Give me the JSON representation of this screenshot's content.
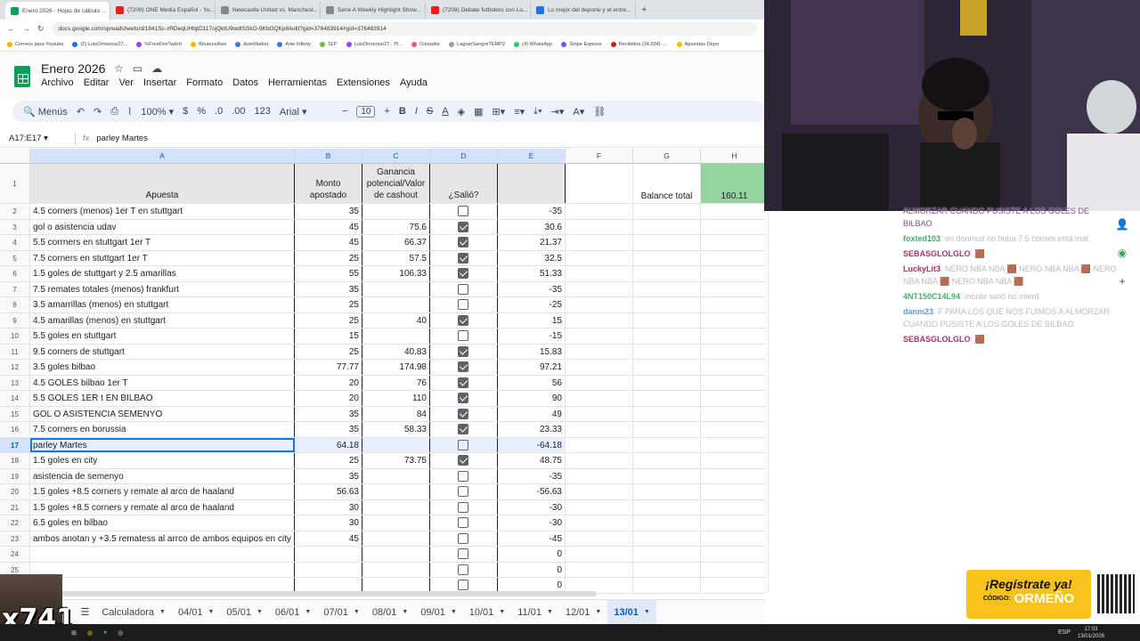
{
  "browser": {
    "tabs": [
      {
        "label": "Enero 2026 - Hojas de cálculo ...",
        "active": true,
        "color": "#0f9d58"
      },
      {
        "label": "(7209) ONE Media Español - Yo...",
        "active": false,
        "color": "#e62117"
      },
      {
        "label": "Newcastle United vs. Manchest...",
        "active": false,
        "color": "#888888"
      },
      {
        "label": "Serie A Weekly Highlight Show...",
        "active": false,
        "color": "#888888"
      },
      {
        "label": "(7209) Debate futbolero con Lo...",
        "active": false,
        "color": "#e62117"
      },
      {
        "label": "Lo mejor del deporte y el entre...",
        "active": false,
        "color": "#1a73e8"
      }
    ],
    "url": "docs.google.com/spreadsheets/d/1841Sc-zRDeqUHbjtD117ojQktU9wdtSSkO-9KbOQKp8/edit?gid=376483914#gid=376483914",
    "bookmarks": [
      "Correos para Youtube",
      "(2) LuisOrmenoe27...",
      "%FreeFireTwitch",
      "BinanceAxie",
      "AxieMarket",
      "Axie Infinity",
      "SLP",
      "LuisOrmenoe27 - Pl...",
      "Contador",
      "LagranSangreTEMP2",
      "(4) WhatsApp",
      "Stripe Express",
      "Recibidos (34,934) -...",
      "Apuestas Depo"
    ]
  },
  "doc": {
    "title": "Enero 2026",
    "menu": [
      "Archivo",
      "Editar",
      "Ver",
      "Insertar",
      "Formato",
      "Datos",
      "Herramientas",
      "Extensiones",
      "Ayuda"
    ]
  },
  "toolbar": {
    "search": "Menús",
    "zoom": "100%",
    "currency": "$",
    "percent": "%",
    "dec_less": ".0",
    "dec_more": ".00",
    "numfmt": "123",
    "font": "Arial",
    "font_size": "10"
  },
  "formula": {
    "namebox": "A17:E17",
    "fx": "fx",
    "value": "parley Martes"
  },
  "columns": [
    "A",
    "B",
    "C",
    "D",
    "E",
    "F",
    "G",
    "H"
  ],
  "header_row": {
    "num": "1",
    "apuesta": "Apuesta",
    "monto": "Monto apostado",
    "ganancia": "Ganancia potencial/Valor de cashout",
    "salio": "¿Salió?",
    "balance_label": "Balance total",
    "balance_value": "160.11"
  },
  "rows": [
    {
      "n": "2",
      "a": "4.5 corners (menos) 1er T en stuttgart",
      "b": "35",
      "c": "",
      "d": false,
      "e": "-35"
    },
    {
      "n": "3",
      "a": "gol o asistencia udav",
      "b": "45",
      "c": "75.6",
      "d": true,
      "e": "30.6"
    },
    {
      "n": "4",
      "a": "5.5 corrners en stuttgart 1er T",
      "b": "45",
      "c": "66.37",
      "d": true,
      "e": "21.37"
    },
    {
      "n": "5",
      "a": "7.5 corners en stuttgart 1er T",
      "b": "25",
      "c": "57.5",
      "d": true,
      "e": "32.5"
    },
    {
      "n": "6",
      "a": "1.5 goles de stuttgart y 2.5 amarillas",
      "b": "55",
      "c": "106.33",
      "d": true,
      "e": "51.33"
    },
    {
      "n": "7",
      "a": "7.5 remates totales (menos) frankfurt",
      "b": "35",
      "c": "",
      "d": false,
      "e": "-35"
    },
    {
      "n": "8",
      "a": "3.5 amarrillas (menos) en stuttgart",
      "b": "25",
      "c": "",
      "d": false,
      "e": "-25"
    },
    {
      "n": "9",
      "a": "4.5 amarillas (menos) en stuttgart",
      "b": "25",
      "c": "40",
      "d": true,
      "e": "15"
    },
    {
      "n": "10",
      "a": "5.5 goles en stuttgart",
      "b": "15",
      "c": "",
      "d": false,
      "e": "-15"
    },
    {
      "n": "11",
      "a": "9.5 corners de stuttgart",
      "b": "25",
      "c": "40.83",
      "d": true,
      "e": "15.83"
    },
    {
      "n": "12",
      "a": "3.5 goles bilbao",
      "b": "77.77",
      "c": "174.98",
      "d": true,
      "e": "97.21"
    },
    {
      "n": "13",
      "a": "4.5 GOLES bilbao 1er T",
      "b": "20",
      "c": "76",
      "d": true,
      "e": "56"
    },
    {
      "n": "14",
      "a": "5.5 GOLES 1ER t EN BILBAO",
      "b": "20",
      "c": "110",
      "d": true,
      "e": "90"
    },
    {
      "n": "15",
      "a": "GOL O ASISTENCIA SEMENYO",
      "b": "35",
      "c": "84",
      "d": true,
      "e": "49"
    },
    {
      "n": "16",
      "a": "7.5 corners en borussia",
      "b": "35",
      "c": "58.33",
      "d": true,
      "e": "23.33"
    },
    {
      "n": "17",
      "a": "parley Martes",
      "b": "64.18",
      "c": "",
      "d": false,
      "e": "-64.18",
      "selected": true
    },
    {
      "n": "18",
      "a": "1.5 goles en city",
      "b": "25",
      "c": "73.75",
      "d": true,
      "e": "48.75"
    },
    {
      "n": "19",
      "a": "asistencia de semenyo",
      "b": "35",
      "c": "",
      "d": false,
      "e": "-35"
    },
    {
      "n": "20",
      "a": "1.5 goles +8.5 corners y remate al arco de haaland",
      "b": "56.63",
      "c": "",
      "d": false,
      "e": "-56.63"
    },
    {
      "n": "21",
      "a": "1.5 goles +8.5 corners y remate al arco de haaland",
      "b": "30",
      "c": "",
      "d": false,
      "e": "-30"
    },
    {
      "n": "22",
      "a": "6.5 goles en bilbao",
      "b": "30",
      "c": "",
      "d": false,
      "e": "-30"
    },
    {
      "n": "23",
      "a": "ambos anotan y +3.5 rematess al arrco de ambos equipos en city",
      "b": "45",
      "c": "",
      "d": false,
      "e": "-45"
    },
    {
      "n": "24",
      "a": "",
      "b": "",
      "c": "",
      "d": false,
      "e": "0"
    },
    {
      "n": "25",
      "a": "",
      "b": "",
      "c": "",
      "d": false,
      "e": "0"
    },
    {
      "n": "26",
      "a": "",
      "b": "",
      "c": "",
      "d": false,
      "e": "0"
    }
  ],
  "sheet_tabs": [
    "Calculadora",
    "04/01",
    "05/01",
    "06/01",
    "07/01",
    "08/01",
    "09/01",
    "10/01",
    "11/01",
    "12/01",
    "13/01"
  ],
  "active_sheet": "13/01",
  "chat": [
    {
      "user": "",
      "text": "ALMORZAR CUANDO PUSISTE A LOS GOLES DE BILBAO",
      "color": "#7a4a9a"
    },
    {
      "user": "foxted103",
      "text": ": en donmuit no huba 7.5 cornes está mal",
      "color": "#3cb371"
    },
    {
      "user": "SEBASGLOLGLO",
      "text": ": 🟫",
      "color": "#b0306a"
    },
    {
      "user": "LuckyLit3",
      "text": ": NERO NBA NBA 🟫 NERO NBA NBA 🟫 NERO NBA NBA 🟫 NERO NBA NBA 🟫",
      "color": "#b0306a"
    },
    {
      "user": "4NT150C14L94",
      "text": ": monte salió no mierd",
      "color": "#3cb371"
    },
    {
      "user": "danm23",
      "text": ": F PARA LOS QUE NOS FUIMOS A ALMORZAR CUANDO PUSISTE A LOS GOLES DE BILBAO",
      "color": "#5a9bd4"
    },
    {
      "user": "SEBASGLOLGLO",
      "text": ": 🟫",
      "color": "#b0306a"
    }
  ],
  "promo": {
    "line1": "¡Regístrate ya!",
    "code_label": "CÓDIGO:",
    "code": "ORMEÑO"
  },
  "overlay_counter": "x741",
  "taskbar": {
    "time": "17:03",
    "date": "13/01/2026",
    "lang": "ESP"
  }
}
